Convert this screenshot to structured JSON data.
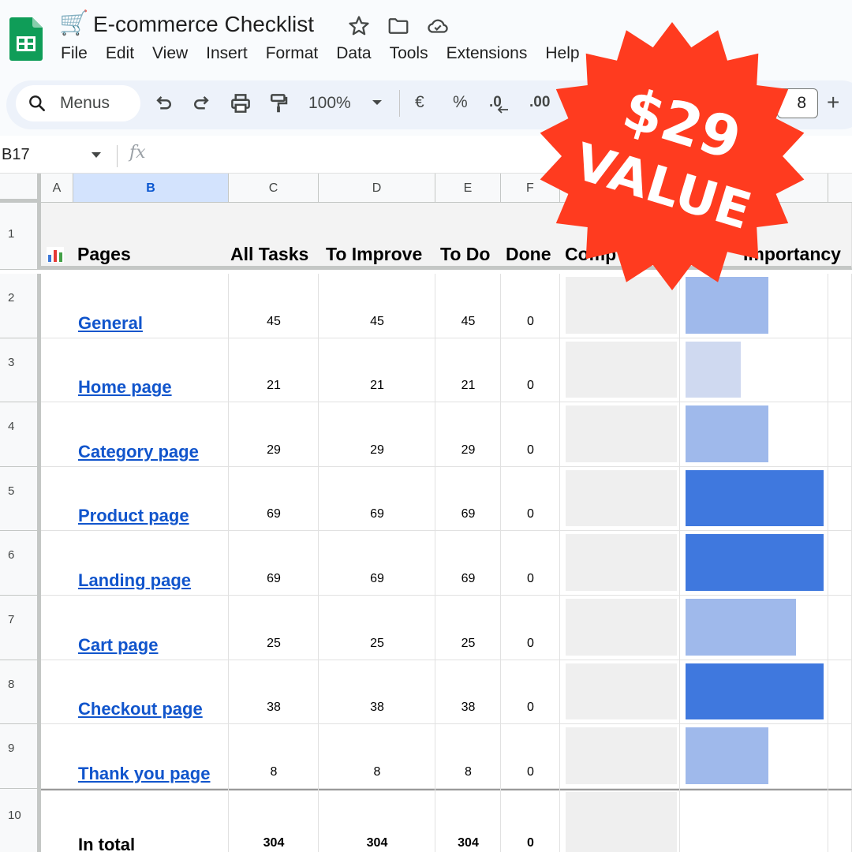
{
  "doc": {
    "emoji": "🛒",
    "title": "E-commerce Checklist",
    "menu": [
      "File",
      "Edit",
      "View",
      "Insert",
      "Format",
      "Data",
      "Tools",
      "Extensions",
      "Help"
    ]
  },
  "toolbar": {
    "search_label": "Menus",
    "zoom": "100%",
    "currency": "€",
    "percent": "%",
    "decrease_decimal": ".0",
    "increase_decimal": ".00",
    "font_size": "8",
    "plus": "+"
  },
  "formula_bar": {
    "name_box": "B17",
    "fx": "fx"
  },
  "columns": [
    "A",
    "B",
    "C",
    "D",
    "E",
    "F"
  ],
  "selected_column": "B",
  "header": {
    "pages": "Pages",
    "all_tasks": "All Tasks",
    "to_improve": "To Improve",
    "to_do": "To Do",
    "done": "Done",
    "completion": "Comp",
    "importancy": "Importancy"
  },
  "rows": [
    {
      "num": "2",
      "page": "General",
      "all": "45",
      "improve": "45",
      "todo": "45",
      "done": "0",
      "importance": 0.6,
      "color": "#9fb9eb"
    },
    {
      "num": "3",
      "page": "Home page",
      "all": "21",
      "improve": "21",
      "todo": "21",
      "done": "0",
      "importance": 0.4,
      "color": "#cfd9f0"
    },
    {
      "num": "4",
      "page": "Category page",
      "all": "29",
      "improve": "29",
      "todo": "29",
      "done": "0",
      "importance": 0.6,
      "color": "#9fb9eb"
    },
    {
      "num": "5",
      "page": "Product page",
      "all": "69",
      "improve": "69",
      "todo": "69",
      "done": "0",
      "importance": 1.0,
      "color": "#3f78de"
    },
    {
      "num": "6",
      "page": "Landing page",
      "all": "69",
      "improve": "69",
      "todo": "69",
      "done": "0",
      "importance": 1.0,
      "color": "#3f78de"
    },
    {
      "num": "7",
      "page": "Cart page",
      "all": "25",
      "improve": "25",
      "todo": "25",
      "done": "0",
      "importance": 0.8,
      "color": "#9fb9eb"
    },
    {
      "num": "8",
      "page": "Checkout page",
      "all": "38",
      "improve": "38",
      "todo": "38",
      "done": "0",
      "importance": 1.0,
      "color": "#3f78de"
    },
    {
      "num": "9",
      "page": "Thank you page ",
      "all": "8",
      "improve": "8",
      "todo": "8",
      "done": "0",
      "importance": 0.6,
      "color": "#9fb9eb"
    }
  ],
  "totals": {
    "num": "10",
    "label": "In total",
    "all": "304",
    "improve": "304",
    "todo": "304",
    "done": "0"
  },
  "badge": {
    "line1": "$29",
    "line2": "VALUE",
    "color": "#ff3b1f"
  }
}
